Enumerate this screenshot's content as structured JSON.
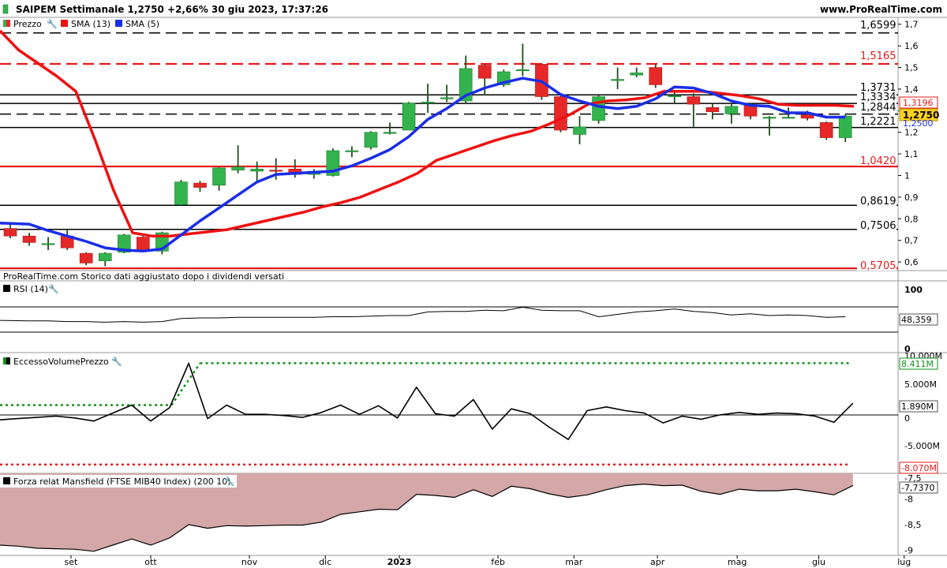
{
  "header": {
    "title": "SAIPEM Settimanale 1,2750 +2,66% 30 giu 2023, 17:37:26",
    "site": "www.ProRealTime.com"
  },
  "legend": {
    "price": "Prezzo",
    "sma13": "SMA (13)",
    "sma5": "SMA (5)"
  },
  "note": "ProRealTime.com  Storico dati aggiustato dopo i dividendi versati",
  "colors": {
    "up": "#33b34d",
    "down": "#e62828",
    "sma13": "#ee1111",
    "sma5": "#1a2ee6",
    "green_dots": "#11911a",
    "red_dots": "#e61a1a",
    "mansfield_fill": "#d4a8a8",
    "current_box": "#ffd21f"
  },
  "x_axis": {
    "labels": [
      {
        "text": "set",
        "week": 3.2
      },
      {
        "text": "ott",
        "week": 7.4
      },
      {
        "text": "nov",
        "week": 12.6
      },
      {
        "text": "dic",
        "week": 16.6
      },
      {
        "text": "2023",
        "week": 20.5
      },
      {
        "text": "feb",
        "week": 25.7
      },
      {
        "text": "mar",
        "week": 29.7
      },
      {
        "text": "apr",
        "week": 34.1
      },
      {
        "text": "mag",
        "week": 38.3
      },
      {
        "text": "giu",
        "week": 42.6
      },
      {
        "text": "lug",
        "week": 47.1
      }
    ]
  },
  "chart_data": [
    {
      "type": "candlestick",
      "title": "SAIPEM Settimanale",
      "ylim": [
        0.56,
        1.71
      ],
      "yticks": [
        {
          "v": 0.6,
          "t": "0,6"
        },
        {
          "v": 0.7,
          "t": "0,7"
        },
        {
          "v": 0.8,
          "t": "0,8"
        },
        {
          "v": 0.9,
          "t": "0,9"
        },
        {
          "v": 1.0,
          "t": "1"
        },
        {
          "v": 1.1,
          "t": "1,1"
        },
        {
          "v": 1.2,
          "t": "1,2"
        },
        {
          "v": 1.3,
          "t": "1,3"
        },
        {
          "v": 1.4,
          "t": "1,4"
        },
        {
          "v": 1.5,
          "t": "1,5"
        },
        {
          "v": 1.6,
          "t": "1,6"
        },
        {
          "v": 1.7,
          "t": "1,7"
        }
      ],
      "candles": [
        {
          "o": 0.755,
          "h": 0.775,
          "l": 0.71,
          "c": 0.72
        },
        {
          "o": 0.72,
          "h": 0.735,
          "l": 0.675,
          "c": 0.69
        },
        {
          "o": 0.685,
          "h": 0.715,
          "l": 0.655,
          "c": 0.685
        },
        {
          "o": 0.72,
          "h": 0.75,
          "l": 0.655,
          "c": 0.665
        },
        {
          "o": 0.64,
          "h": 0.645,
          "l": 0.585,
          "c": 0.595
        },
        {
          "o": 0.605,
          "h": 0.645,
          "l": 0.58,
          "c": 0.64
        },
        {
          "o": 0.645,
          "h": 0.73,
          "l": 0.64,
          "c": 0.725
        },
        {
          "o": 0.715,
          "h": 0.72,
          "l": 0.645,
          "c": 0.65
        },
        {
          "o": 0.65,
          "h": 0.74,
          "l": 0.635,
          "c": 0.735
        },
        {
          "o": 0.865,
          "h": 0.98,
          "l": 0.86,
          "c": 0.97
        },
        {
          "o": 0.965,
          "h": 0.975,
          "l": 0.925,
          "c": 0.945
        },
        {
          "o": 0.955,
          "h": 1.04,
          "l": 0.93,
          "c": 1.035
        },
        {
          "o": 1.025,
          "h": 1.14,
          "l": 1.01,
          "c": 1.04
        },
        {
          "o": 1.02,
          "h": 1.065,
          "l": 0.965,
          "c": 1.03
        },
        {
          "o": 1.025,
          "h": 1.08,
          "l": 0.98,
          "c": 1.02
        },
        {
          "o": 1.03,
          "h": 1.075,
          "l": 0.99,
          "c": 1.005
        },
        {
          "o": 1.005,
          "h": 1.03,
          "l": 0.985,
          "c": 1.02
        },
        {
          "o": 1.0,
          "h": 1.125,
          "l": 0.995,
          "c": 1.115
        },
        {
          "o": 1.115,
          "h": 1.135,
          "l": 1.085,
          "c": 1.115
        },
        {
          "o": 1.13,
          "h": 1.205,
          "l": 1.12,
          "c": 1.2
        },
        {
          "o": 1.2,
          "h": 1.245,
          "l": 1.19,
          "c": 1.2
        },
        {
          "o": 1.21,
          "h": 1.34,
          "l": 1.21,
          "c": 1.335
        },
        {
          "o": 1.34,
          "h": 1.425,
          "l": 1.29,
          "c": 1.34
        },
        {
          "o": 1.36,
          "h": 1.42,
          "l": 1.34,
          "c": 1.36
        },
        {
          "o": 1.345,
          "h": 1.555,
          "l": 1.33,
          "c": 1.495
        },
        {
          "o": 1.51,
          "h": 1.515,
          "l": 1.37,
          "c": 1.45
        },
        {
          "o": 1.42,
          "h": 1.49,
          "l": 1.41,
          "c": 1.48
        },
        {
          "o": 1.49,
          "h": 1.61,
          "l": 1.46,
          "c": 1.49
        },
        {
          "o": 1.515,
          "h": 1.52,
          "l": 1.35,
          "c": 1.365
        },
        {
          "o": 1.365,
          "h": 1.37,
          "l": 1.2,
          "c": 1.21
        },
        {
          "o": 1.19,
          "h": 1.275,
          "l": 1.145,
          "c": 1.225
        },
        {
          "o": 1.255,
          "h": 1.37,
          "l": 1.24,
          "c": 1.365
        },
        {
          "o": 1.445,
          "h": 1.5,
          "l": 1.4,
          "c": 1.445
        },
        {
          "o": 1.465,
          "h": 1.5,
          "l": 1.455,
          "c": 1.475
        },
        {
          "o": 1.5,
          "h": 1.515,
          "l": 1.405,
          "c": 1.42
        },
        {
          "o": 1.37,
          "h": 1.395,
          "l": 1.33,
          "c": 1.37
        },
        {
          "o": 1.365,
          "h": 1.38,
          "l": 1.225,
          "c": 1.33
        },
        {
          "o": 1.315,
          "h": 1.33,
          "l": 1.26,
          "c": 1.295
        },
        {
          "o": 1.285,
          "h": 1.33,
          "l": 1.24,
          "c": 1.32
        },
        {
          "o": 1.325,
          "h": 1.335,
          "l": 1.26,
          "c": 1.275
        },
        {
          "o": 1.27,
          "h": 1.275,
          "l": 1.185,
          "c": 1.27
        },
        {
          "o": 1.27,
          "h": 1.315,
          "l": 1.265,
          "c": 1.27
        },
        {
          "o": 1.28,
          "h": 1.3,
          "l": 1.255,
          "c": 1.265
        },
        {
          "o": 1.245,
          "h": 1.25,
          "l": 1.165,
          "c": 1.175
        },
        {
          "o": 1.175,
          "h": 1.285,
          "l": 1.155,
          "c": 1.275
        }
      ],
      "sma13": [
        1.67,
        1.58,
        1.52,
        1.46,
        1.39,
        1.17,
        0.93,
        0.735,
        0.72,
        0.72,
        0.73,
        0.74,
        0.75,
        0.77,
        0.79,
        0.81,
        0.83,
        0.855,
        0.875,
        0.9,
        0.935,
        0.97,
        1.01,
        1.07,
        1.1,
        1.13,
        1.16,
        1.185,
        1.205,
        1.24,
        1.28,
        1.33,
        1.345,
        1.35,
        1.36,
        1.39,
        1.39,
        1.39,
        1.38,
        1.37,
        1.355,
        1.33,
        1.325,
        1.325,
        1.325,
        1.32
      ],
      "sma5": [
        0.78,
        0.775,
        0.745,
        0.72,
        0.695,
        0.665,
        0.655,
        0.65,
        0.66,
        0.725,
        0.79,
        0.85,
        0.91,
        0.97,
        1.005,
        1.01,
        1.015,
        1.02,
        1.045,
        1.08,
        1.12,
        1.18,
        1.26,
        1.31,
        1.37,
        1.405,
        1.43,
        1.45,
        1.435,
        1.375,
        1.345,
        1.32,
        1.31,
        1.32,
        1.355,
        1.41,
        1.405,
        1.38,
        1.345,
        1.325,
        1.32,
        1.29,
        1.29,
        1.27,
        1.27
      ],
      "levels": [
        {
          "value": 1.6599,
          "label": "1,6599",
          "style": "dash",
          "color": "#000000"
        },
        {
          "value": 1.5165,
          "label": "1,5165",
          "style": "dash",
          "color": "#e61a1a"
        },
        {
          "value": 1.3731,
          "label": "1,3731",
          "style": "solid",
          "color": "#000000"
        },
        {
          "value": 1.3334,
          "label": "1,3334",
          "style": "solid",
          "color": "#000000"
        },
        {
          "value": 1.2844,
          "label": "1,2844",
          "style": "dash",
          "color": "#000000"
        },
        {
          "value": 1.2221,
          "label": "1,2221",
          "style": "solid",
          "color": "#000000"
        },
        {
          "value": 1.042,
          "label": "1,0420",
          "style": "solid",
          "color": "#e61a1a"
        },
        {
          "value": 0.8619,
          "label": "0,8619",
          "style": "solid",
          "color": "#000000"
        },
        {
          "value": 0.7506,
          "label": "0,7506",
          "style": "solid",
          "color": "#000000"
        },
        {
          "value": 0.5705,
          "label": "0,5705",
          "style": "solid",
          "color": "#e61a1a"
        }
      ],
      "last_values": {
        "sma13": {
          "value": 1.3196,
          "label": "1,3196"
        },
        "price": {
          "value": 1.275,
          "label": "1,2750"
        },
        "sma5": {
          "value": 1.25,
          "label": "1,2500"
        }
      }
    },
    {
      "type": "line",
      "title": "RSI (14)",
      "ylim": [
        0,
        100
      ],
      "ytick_label": "100",
      "ytick_bottom": "0",
      "values": [
        42,
        41,
        41,
        40,
        40,
        39,
        40,
        39,
        40,
        45,
        46,
        46,
        47,
        47,
        47,
        47,
        47,
        48,
        48,
        49,
        50,
        50,
        56,
        57,
        57,
        59,
        58,
        64,
        59,
        58,
        58,
        48,
        52,
        56,
        58,
        61,
        57,
        55,
        51,
        53,
        50,
        51,
        50,
        47,
        48
      ],
      "last_label": "48,359"
    },
    {
      "type": "line",
      "title": "EccessoVolumePrezzo",
      "ylim": [
        -9.5,
        10.0
      ],
      "yticks": [
        {
          "v": 5.0,
          "t": "5.000M"
        },
        {
          "v": 0,
          "t": "0"
        },
        {
          "v": -5.0,
          "t": "-5.000M"
        }
      ],
      "top_label_partial": "10.000M",
      "values": [
        -0.8,
        -0.6,
        -0.4,
        -0.2,
        -0.5,
        -1.0,
        0.3,
        1.6,
        -1.0,
        1.2,
        8.4,
        -0.6,
        1.6,
        0.1,
        0.1,
        -0.1,
        -0.4,
        0.4,
        1.6,
        0.1,
        1.5,
        -0.5,
        4.5,
        0.2,
        -0.2,
        2.5,
        -2.3,
        1.0,
        0.2,
        -2.0,
        -4.0,
        0.7,
        1.3,
        0.7,
        0.3,
        -1.3,
        -0.2,
        -0.7,
        0.0,
        0.4,
        0.1,
        0.3,
        0.2,
        -0.2,
        -1.2,
        1.9
      ],
      "upper_dotted": {
        "value": 8.411,
        "label": "8.411M"
      },
      "lower_dotted": {
        "value": -8.07,
        "label": "-8.070M"
      },
      "last_label": "1.890M",
      "zero_label": "0"
    },
    {
      "type": "area",
      "title": "Forza relat Mansfield (FTSE MIB40 Index) (200 10)",
      "ylim": [
        -9.1,
        -7.5
      ],
      "yticks": [
        {
          "v": -8.0,
          "t": "-8"
        },
        {
          "v": -8.5,
          "t": "-8,5"
        },
        {
          "v": -9.0,
          "t": "-9"
        }
      ],
      "top_label_partial": "-7,5",
      "values": [
        -8.9,
        -8.92,
        -8.96,
        -8.97,
        -8.98,
        -9.02,
        -8.9,
        -8.78,
        -8.9,
        -8.76,
        -8.5,
        -8.57,
        -8.52,
        -8.53,
        -8.52,
        -8.51,
        -8.51,
        -8.45,
        -8.3,
        -8.25,
        -8.2,
        -8.21,
        -7.91,
        -7.93,
        -7.97,
        -7.82,
        -7.95,
        -7.75,
        -7.8,
        -7.9,
        -7.97,
        -7.92,
        -7.82,
        -7.74,
        -7.71,
        -7.74,
        -7.73,
        -7.85,
        -7.91,
        -7.81,
        -7.84,
        -7.84,
        -7.81,
        -7.86,
        -7.92,
        -7.737
      ],
      "last_label": "-7,7370"
    }
  ]
}
